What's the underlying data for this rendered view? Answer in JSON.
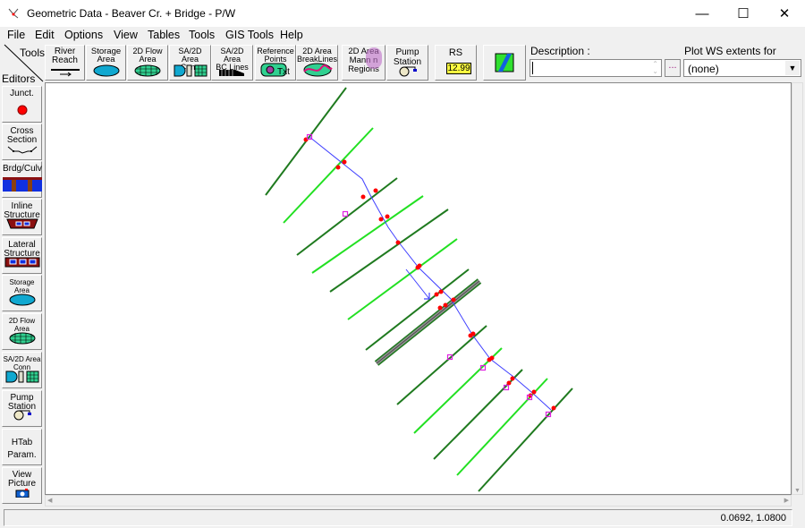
{
  "window": {
    "title": "Geometric Data - Beaver Cr. + Bridge - P/W",
    "minimize_icon": "minimize-icon",
    "maximize_icon": "maximize-icon",
    "close_icon": "close-icon"
  },
  "menu": [
    "File",
    "Edit",
    "Options",
    "View",
    "Tables",
    "Tools",
    "GIS Tools",
    "Help"
  ],
  "toolbar": {
    "tools_label": "Tools",
    "editors_label": "Editors",
    "buttons": [
      {
        "l1": "River",
        "l2": "Reach"
      },
      {
        "l1": "Storage",
        "l2": "Area"
      },
      {
        "l1": "2D Flow",
        "l2": "Area"
      },
      {
        "l1": "SA/2D Area",
        "l2": "Conn"
      },
      {
        "l1": "SA/2D Area",
        "l2": "BC Lines"
      },
      {
        "l1": "Reference",
        "l2": "Points"
      },
      {
        "l1": "2D Area",
        "l2": "BreakLines"
      },
      {
        "l1": "2D Area",
        "l2": "Mann n",
        "l3": "Regions"
      },
      {
        "l1": "Pump",
        "l2": "Station"
      },
      {
        "l1": "RS",
        "l2": "12.99"
      }
    ],
    "description_label": "Description :",
    "description_value": "",
    "browse_label": "...",
    "plot_ws_label": "Plot WS extents for Profile:",
    "plot_ws_value": "(none)"
  },
  "editors": [
    {
      "l1": "Junct.",
      "l2": ""
    },
    {
      "l1": "Cross",
      "l2": "Section"
    },
    {
      "l1": "Brdg/Culv",
      "l2": ""
    },
    {
      "l1": "Inline",
      "l2": "Structure"
    },
    {
      "l1": "Lateral",
      "l2": "Structure"
    },
    {
      "l1": "Storage",
      "l2": "Area"
    },
    {
      "l1": "2D Flow",
      "l2": "Area"
    },
    {
      "l1": "SA/2D Area",
      "l2": "Conn"
    },
    {
      "l1": "Pump",
      "l2": "Station"
    },
    {
      "l1": "HTab",
      "l2": "Param."
    },
    {
      "l1": "View",
      "l2": "Picture"
    }
  ],
  "status": {
    "coordinates": "0.0692, 1.0800"
  },
  "colors": {
    "river": "#4040ff",
    "xs_dark": "#1f7a1f",
    "xs_light": "#22e022",
    "point": "#ff0000",
    "marker": "#e020e0",
    "bridge": "#909090"
  }
}
